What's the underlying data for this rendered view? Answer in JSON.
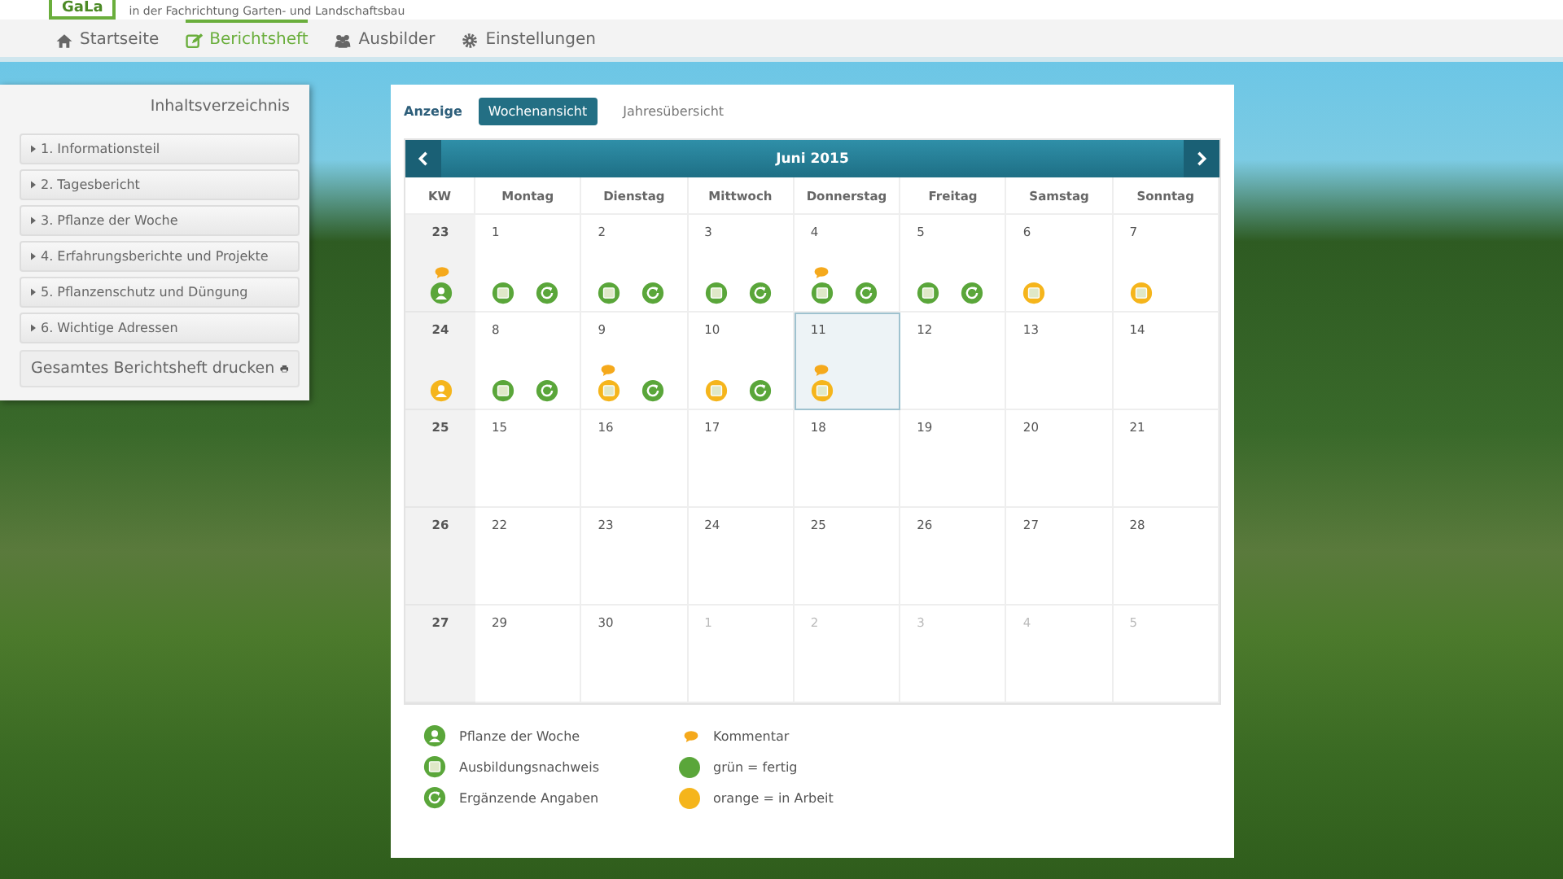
{
  "header": {
    "logo": "GaLa",
    "tagline": "in der Fachrichtung Garten- und Landschaftsbau"
  },
  "nav": [
    {
      "label": "Startseite",
      "selected": false
    },
    {
      "label": "Berichtsheft",
      "selected": true
    },
    {
      "label": "Ausbilder",
      "selected": false
    },
    {
      "label": "Einstellungen",
      "selected": false
    }
  ],
  "sidebar": {
    "title": "Inhaltsverzeichnis",
    "items": [
      "1. Informationsteil",
      "2. Tagesbericht",
      "3. Pflanze der Woche",
      "4. Erfahrungsberichte und Projekte",
      "5. Pflanzenschutz und Düngung",
      "6. Wichtige Adressen"
    ],
    "print_button": "Gesamtes Berichtsheft drucken"
  },
  "view": {
    "label": "Anzeige",
    "tabs": [
      {
        "label": "Wochenansicht",
        "selected": true
      },
      {
        "label": "Jahresübersicht",
        "selected": false
      }
    ]
  },
  "calendar": {
    "month": "Juni 2015",
    "columns": [
      "KW",
      "Montag",
      "Dienstag",
      "Mittwoch",
      "Donnerstag",
      "Freitag",
      "Samstag",
      "Sonntag"
    ],
    "weeks": [
      {
        "kw": "23",
        "comment": true,
        "icons": [
          {
            "kind": "plant",
            "color": "#5aa63a"
          }
        ],
        "days": [
          {
            "day": "1",
            "muted": false,
            "selected": false,
            "comment": false,
            "icons": [
              {
                "kind": "record",
                "color": "#5aa63a"
              },
              {
                "kind": "extra",
                "color": "#5aa63a"
              }
            ]
          },
          {
            "day": "2",
            "muted": false,
            "selected": false,
            "comment": false,
            "icons": [
              {
                "kind": "record",
                "color": "#5aa63a"
              },
              {
                "kind": "extra",
                "color": "#5aa63a"
              }
            ]
          },
          {
            "day": "3",
            "muted": false,
            "selected": false,
            "comment": false,
            "icons": [
              {
                "kind": "record",
                "color": "#5aa63a"
              },
              {
                "kind": "extra",
                "color": "#5aa63a"
              }
            ]
          },
          {
            "day": "4",
            "muted": false,
            "selected": false,
            "comment": true,
            "icons": [
              {
                "kind": "record",
                "color": "#5aa63a"
              },
              {
                "kind": "extra",
                "color": "#5aa63a"
              }
            ]
          },
          {
            "day": "5",
            "muted": false,
            "selected": false,
            "comment": false,
            "icons": [
              {
                "kind": "record",
                "color": "#5aa63a"
              },
              {
                "kind": "extra",
                "color": "#5aa63a"
              }
            ]
          },
          {
            "day": "6",
            "muted": false,
            "selected": false,
            "comment": false,
            "icons": [
              {
                "kind": "record",
                "color": "#f5b51c"
              }
            ]
          },
          {
            "day": "7",
            "muted": false,
            "selected": false,
            "comment": false,
            "icons": [
              {
                "kind": "record",
                "color": "#f5b51c"
              }
            ]
          }
        ]
      },
      {
        "kw": "24",
        "comment": false,
        "icons": [
          {
            "kind": "plant",
            "color": "#f5b51c"
          }
        ],
        "days": [
          {
            "day": "8",
            "muted": false,
            "selected": false,
            "comment": false,
            "icons": [
              {
                "kind": "record",
                "color": "#5aa63a"
              },
              {
                "kind": "extra",
                "color": "#5aa63a"
              }
            ]
          },
          {
            "day": "9",
            "muted": false,
            "selected": false,
            "comment": true,
            "icons": [
              {
                "kind": "record",
                "color": "#f5b51c"
              },
              {
                "kind": "extra",
                "color": "#5aa63a"
              }
            ]
          },
          {
            "day": "10",
            "muted": false,
            "selected": false,
            "comment": false,
            "icons": [
              {
                "kind": "record",
                "color": "#f5b51c"
              },
              {
                "kind": "extra",
                "color": "#5aa63a"
              }
            ]
          },
          {
            "day": "11",
            "muted": false,
            "selected": true,
            "comment": true,
            "icons": [
              {
                "kind": "record",
                "color": "#f5b51c"
              }
            ]
          },
          {
            "day": "12",
            "muted": false,
            "selected": false,
            "comment": false
          },
          {
            "day": "13",
            "muted": false,
            "selected": false,
            "comment": false
          },
          {
            "day": "14",
            "muted": false,
            "selected": false,
            "comment": false
          }
        ]
      },
      {
        "kw": "25",
        "comment": false,
        "days": [
          {
            "day": "15",
            "muted": false,
            "selected": false,
            "comment": false
          },
          {
            "day": "16",
            "muted": false,
            "selected": false,
            "comment": false
          },
          {
            "day": "17",
            "muted": false,
            "selected": false,
            "comment": false
          },
          {
            "day": "18",
            "muted": false,
            "selected": false,
            "comment": false
          },
          {
            "day": "19",
            "muted": false,
            "selected": false,
            "comment": false
          },
          {
            "day": "20",
            "muted": false,
            "selected": false,
            "comment": false
          },
          {
            "day": "21",
            "muted": false,
            "selected": false,
            "comment": false
          }
        ]
      },
      {
        "kw": "26",
        "comment": false,
        "days": [
          {
            "day": "22",
            "muted": false,
            "selected": false,
            "comment": false
          },
          {
            "day": "23",
            "muted": false,
            "selected": false,
            "comment": false
          },
          {
            "day": "24",
            "muted": false,
            "selected": false,
            "comment": false
          },
          {
            "day": "25",
            "muted": false,
            "selected": false,
            "comment": false
          },
          {
            "day": "26",
            "muted": false,
            "selected": false,
            "comment": false
          },
          {
            "day": "27",
            "muted": false,
            "selected": false,
            "comment": false
          },
          {
            "day": "28",
            "muted": false,
            "selected": false,
            "comment": false
          }
        ]
      },
      {
        "kw": "27",
        "comment": false,
        "days": [
          {
            "day": "29",
            "muted": false,
            "selected": false,
            "comment": false
          },
          {
            "day": "30",
            "muted": false,
            "selected": false,
            "comment": false
          },
          {
            "day": "1",
            "muted": true,
            "selected": false,
            "comment": false
          },
          {
            "day": "2",
            "muted": true,
            "selected": false,
            "comment": false
          },
          {
            "day": "3",
            "muted": true,
            "selected": false,
            "comment": false
          },
          {
            "day": "4",
            "muted": true,
            "selected": false,
            "comment": false
          },
          {
            "day": "5",
            "muted": true,
            "selected": false,
            "comment": false
          }
        ]
      }
    ]
  },
  "legend": [
    [
      {
        "kind": "plant",
        "label": "Pflanze der Woche"
      },
      {
        "kind": "record",
        "label": "Ausbildungsnachweis"
      },
      {
        "kind": "extra",
        "label": "Ergänzende Angaben"
      }
    ],
    [
      {
        "kind": "comment",
        "label": "Kommentar"
      },
      {
        "kind": "dot",
        "color": "#5aa63a",
        "label": "grün = fertig"
      },
      {
        "kind": "dot",
        "color": "#f5b51c",
        "label": "orange = in Arbeit"
      }
    ]
  ]
}
